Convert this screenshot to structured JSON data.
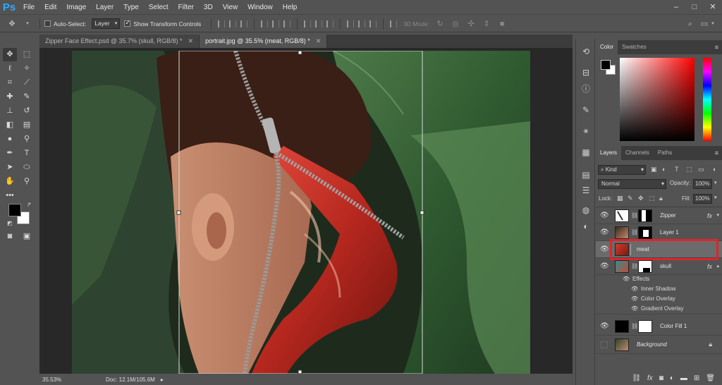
{
  "app": {
    "logo": "Ps"
  },
  "menu": [
    "File",
    "Edit",
    "Image",
    "Layer",
    "Type",
    "Select",
    "Filter",
    "3D",
    "View",
    "Window",
    "Help"
  ],
  "window_controls": [
    "–",
    "□",
    "✕"
  ],
  "options": {
    "auto_select_label": "Auto-Select:",
    "auto_select_target": "Layer",
    "show_transform_label": "Show Transform Controls",
    "mode_3d_label": "3D Mode:"
  },
  "tabs": [
    {
      "label": "Zipper Face Effect.psd @ 35.7% (skull, RGB/8) *",
      "active": false
    },
    {
      "label": "portrait.jpg @ 35.5% (meat, RGB/8) *",
      "active": true
    }
  ],
  "status": {
    "zoom": "35.53%",
    "doc": "Doc: 12.1M/105.6M"
  },
  "color_panel": {
    "tabs": [
      "Color",
      "Swatches"
    ],
    "foreground": "#000000",
    "background": "#ffffff"
  },
  "layers_panel": {
    "tabs": [
      "Layers",
      "Channels",
      "Paths"
    ],
    "filter_kind": "Kind",
    "blend_mode": "Normal",
    "opacity_label": "Opacity:",
    "opacity_value": "100%",
    "lock_label": "Lock:",
    "fill_label": "Fill:",
    "fill_value": "100%",
    "layers": [
      {
        "name": "Zipper",
        "fx": "fx",
        "selected": false
      },
      {
        "name": "Layer 1",
        "fx": "",
        "selected": false
      },
      {
        "name": "meat",
        "fx": "",
        "selected": true
      },
      {
        "name": "skull",
        "fx": "fx",
        "selected": false
      },
      {
        "name": "Color Fill 1",
        "fx": "",
        "selected": false
      },
      {
        "name": "Background",
        "fx": "",
        "selected": false
      }
    ],
    "effects_label": "Effects",
    "effects": [
      "Inner Shadow",
      "Color Overlay",
      "Gradient Overlay"
    ]
  },
  "colors": {
    "highlight": "#e0242c",
    "selected_row": "#6b6b6b",
    "accent": "#31a8ff"
  }
}
